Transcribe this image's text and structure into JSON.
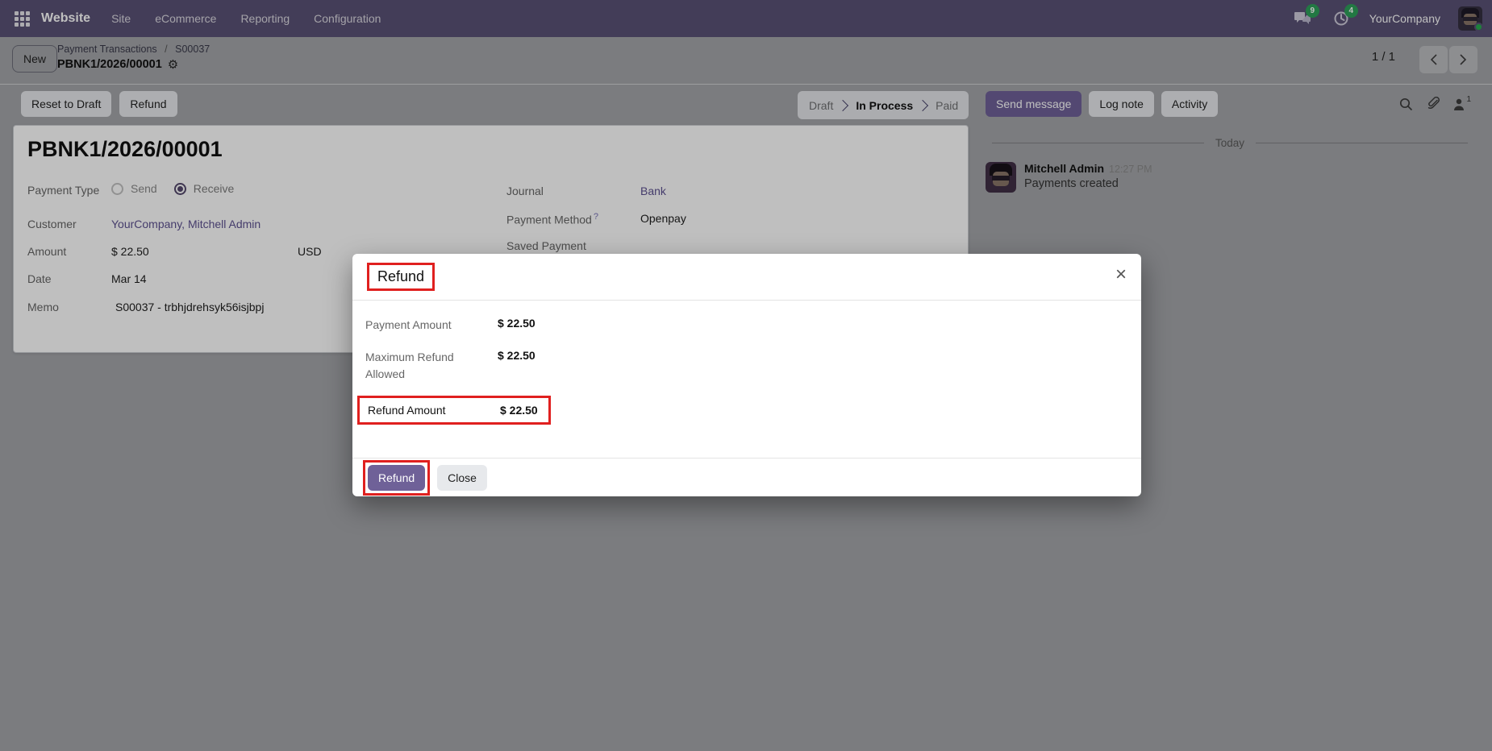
{
  "colors": {
    "accent": "#6f6198",
    "navbar_bg": "#5a5276",
    "annotation_red": "#e0201f",
    "badge_green": "#2ea15a",
    "link": "#5d5190"
  },
  "navbar": {
    "brand": "Website",
    "menus": [
      {
        "label": "Site"
      },
      {
        "label": "eCommerce"
      },
      {
        "label": "Reporting"
      },
      {
        "label": "Configuration"
      }
    ],
    "messages_badge": "9",
    "activities_badge": "4",
    "company": "YourCompany"
  },
  "control_panel": {
    "new_label": "New",
    "breadcrumb_parent": "Payment Transactions",
    "breadcrumb_sep": "/",
    "breadcrumb_current": "S00037",
    "record_name": "PBNK1/2026/00001",
    "gear_icon": "⚙",
    "pager": "1 / 1"
  },
  "action_bar": {
    "reset_label": "Reset to Draft",
    "refund_label": "Refund",
    "stages": [
      {
        "label": "Draft"
      },
      {
        "label": "In Process"
      },
      {
        "label": "Paid"
      }
    ],
    "active_stage": "In Process",
    "send_message": "Send message",
    "log_note": "Log note",
    "activity": "Activity",
    "follower_count": "1"
  },
  "form": {
    "title": "PBNK1/2026/00001",
    "payment_type_label": "Payment Type",
    "send_label": "Send",
    "receive_label": "Receive",
    "customer_label": "Customer",
    "customer_value": "YourCompany, Mitchell Admin",
    "amount_label": "Amount",
    "amount_value": "$ 22.50",
    "currency": "USD",
    "date_label": "Date",
    "date_value": "Mar 14",
    "memo_label": "Memo",
    "memo_value": "S00037 - trbhjdrehsyk56isjbpj",
    "journal_label": "Journal",
    "journal_value": "Bank",
    "payment_method_label": "Payment Method",
    "payment_method_help": "?",
    "payment_method_value": "Openpay",
    "saved_payment_label": "Saved Payment"
  },
  "chatter": {
    "date_divider": "Today",
    "author": "Mitchell Admin",
    "time": "12:27 PM",
    "message": "Payments created"
  },
  "modal": {
    "title": "Refund",
    "close": "×",
    "rows": [
      {
        "label": "Payment Amount",
        "value": "$ 22.50"
      },
      {
        "label": "Maximum Refund Allowed",
        "value": "$ 22.50"
      },
      {
        "label": "Refund Amount",
        "value": "$ 22.50"
      }
    ],
    "refund_button": "Refund",
    "close_button": "Close"
  }
}
